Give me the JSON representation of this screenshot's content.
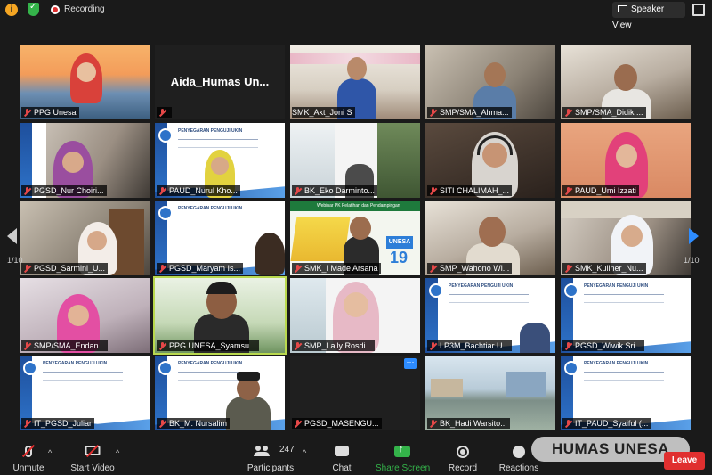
{
  "topbar": {
    "recording_label": "Recording",
    "speaker_view_label": "Speaker View"
  },
  "pagination": {
    "left": "1/10",
    "right": "1/10"
  },
  "participants": [
    {
      "name": "PPG Unesa"
    },
    {
      "name": "Aida_Humas Unesa",
      "display": "Aida_Humas  Un..."
    },
    {
      "name": "SMK_Akt_Joni S"
    },
    {
      "name": "SMP/SMA_Ahma..."
    },
    {
      "name": "SMP/SMA_Didik ..."
    },
    {
      "name": "PGSD_Nur Choiri..."
    },
    {
      "name": "PAUD_Nurul Kho..."
    },
    {
      "name": "BK_Eko Darminto..."
    },
    {
      "name": "SITI CHALIMAH_..."
    },
    {
      "name": "PAUD_Umi Izzati"
    },
    {
      "name": "PGSD_Sarmini_U..."
    },
    {
      "name": "PGSD_Maryam Is..."
    },
    {
      "name": "SMK_I Made Arsana"
    },
    {
      "name": "SMP_Wahono Wi..."
    },
    {
      "name": "SMK_Kuliner_Nu..."
    },
    {
      "name": "SMP/SMA_Endan..."
    },
    {
      "name": "PPG UNESA_Syamsu..."
    },
    {
      "name": "SMP_Laily Rosdi..."
    },
    {
      "name": "LP3M_Bachtiar U..."
    },
    {
      "name": "PGSD_Wiwik Sri..."
    },
    {
      "name": "IT_PGSD_Juliar"
    },
    {
      "name": "BK_M. Nursalim"
    },
    {
      "name": "PGSD_MASENGU..."
    },
    {
      "name": "BK_Hadi Warsito..."
    },
    {
      "name": "IT_PAUD_Syaiful (..."
    }
  ],
  "slide": {
    "title": "PENYEGARAN PENGUJI UKIN",
    "subtitle": "SE. UNIVERSITAS NEGERI SURABAYA",
    "date": "7 November 2020"
  },
  "webinar_banner": {
    "top_text": "Webinar PK Pelatihan dan Pendampingan",
    "big_text": "19",
    "brand": "UNESA"
  },
  "more_button_label": "···",
  "toolbar": {
    "unmute": "Unmute",
    "start_video": "Start Video",
    "participants": "Participants",
    "participant_count": "247",
    "chat": "Chat",
    "share_screen": "Share Screen",
    "record": "Record",
    "reactions": "Reactions",
    "leave": "Leave"
  },
  "watermark": "HUMAS UNESA",
  "colors": {
    "accent_blue": "#2d8cff",
    "share_green": "#34b34a",
    "leave_red": "#e02f2f",
    "active_speaker_outline": "#b9d94e"
  }
}
